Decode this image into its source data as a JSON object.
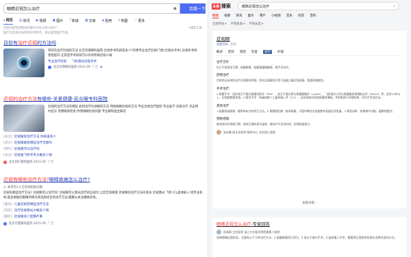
{
  "baidu": {
    "query": "眼睛近视怎么治疗",
    "search_button": "百度一下",
    "tabs": [
      {
        "label": "网页",
        "icon": "search-icon",
        "glyph": "⌕"
      },
      {
        "label": "资讯",
        "icon": "news-icon",
        "glyph": "▤"
      },
      {
        "label": "视频",
        "icon": "video-icon",
        "glyph": "▶"
      },
      {
        "label": "图片",
        "icon": "image-icon",
        "glyph": "▣"
      },
      {
        "label": "知道",
        "icon": "question-icon",
        "glyph": "?"
      },
      {
        "label": "文库",
        "icon": "document-icon",
        "glyph": "▦"
      },
      {
        "label": "贴吧",
        "icon": "forum-icon",
        "glyph": "◈"
      },
      {
        "label": "地图",
        "icon": "map-pin-icon",
        "glyph": "⌾"
      },
      {
        "label": "更多",
        "icon": "more-icon",
        "glyph": "⋯"
      }
    ],
    "result_count": "百度为您找到相关结果约100,000,000个",
    "tools_label": "搜索工具",
    "tip": "医疗信息具有局限性仅供参考，请以医院医疗为准",
    "result1": {
      "title_a": "目前有",
      "title_em": "治疗近视",
      "title_b": "的方法吗",
      "desc": "目前有治疗近视的方法 北京华德眼科医院 近视手术年龄是多少?华德专业治疗近视(飞秒/全激光手术),近视手术改善度提升,尤其是手术前就可以有效帮助近视人群",
      "link1": "专业治疗近视",
      "link2": "飞秒激光近视手术",
      "site": "北京华德眼科医院 2021-09",
      "ad": "广告"
    },
    "result2": {
      "title_em": "近视的治疗方法",
      "title_b": "有哪些-关爱健康-民众眼专科医院",
      "desc": "近视的治疗方法有哪些 如何治疗近视眼的方法 预防眼睛近视的方法 专业近视治疗医院 专业医学 优质诊疗 点击预约挂号 免费眼部检查 改善眼睛近视问题 专业眼科医生解答",
      "subs": [
        {
          "label": "[关注]",
          "text": "近视眼的治疗方法 你知道多少"
        },
        {
          "label": "[问诊]",
          "text": "近视眼能有哪些治疗可能吗"
        },
        {
          "label": "[预约]",
          "text": "近视眼可以治疗吗"
        },
        {
          "label": "[关注]",
          "text": "近视金飞秒手术大概多少钱"
        }
      ],
      "site": "北京同仁眼科医院 2021-09",
      "ad": "广告"
    },
    "result3": {
      "title_em": "近视有哪些治疗方法?",
      "title_b": "眼睛疾病怎么治疗?",
      "note": "本月有1人已咨询相关问题",
      "desc": "近视有哪些治疗方法? 近视眼可以治疗吗? 近视眼可以激光治疗矫正视力 让您告别眼镜 近视眼的治疗方法有很多 近视激光 飞秒 ICL晶体植入 找专业机构,医生根据您眼睛的情况来选择适合的治疗方法,健康从关注眼睛开始。",
      "subs": [
        {
          "label": "[服务]",
          "text": "儿童近视有哪些治疗方法"
        },
        {
          "label": "[问答]",
          "text": "治疗近视激光大概多少钱"
        },
        {
          "label": "[服务]",
          "text": "近视眼多少度算严重"
        }
      ],
      "site": "北京华夏眼科医院 2021-09",
      "ad": "广告"
    }
  },
  "toutiao": {
    "logo_box": "头条",
    "logo_text": "搜索",
    "query": "眼睛近视怎么治疗",
    "tabs": [
      "综合",
      "视频",
      "资讯",
      "图片",
      "用户",
      "小视频",
      "音乐",
      "问答",
      "百科"
    ],
    "filters": [
      "全部时间",
      "不限来源",
      "不限长度"
    ],
    "card": {
      "title": "近视眼",
      "wiki": "百度百科",
      "wiki_extra": "疾病",
      "tabs": [
        "概述",
        "症状",
        "病因",
        "检查",
        "治疗",
        "护理"
      ],
      "active_tab": "治疗",
      "sections": [
        {
          "h": "治疗方针",
          "p": "针正不良视觉习惯、佩戴眼镜、配戴角膜接触镜、做手术治疗。"
        },
        {
          "h": "药物治疗",
          "p": "目前尚无有效的治疗近视眼的药物，阿托品滴眼剂可用于延缓儿童近视进展，需遵医嘱使用。"
        },
        {
          "h": "手术治疗",
          "p": "1.角膜手术：包括准分子激光角膜切削术（PRK）、准分子激光原位角膜磨镶术（LASIK）、飞秒激光小切口角膜基质透镜取出术（SMILE）等，适合18岁以上、近视度数稳定者。2.眼内手术：有晶体眼人工晶体植入术（ICL），适合高度近视或角膜较薄者。术前需进行详细检查，评估手术适应证。"
        },
        {
          "h": "其他治疗",
          "p": "1.配戴框架眼镜：最简单安全的矫正方法。2.角膜塑形镜：夜间佩戴，可暂时降低近视度数并延缓近视发展。3.视觉训练：改善调节功能，缓解视疲劳。"
        },
        {
          "h": "预防措施",
          "p": "养成良好的用眼习惯，保持正确的读写姿势，增加户外活动时间，定期检查视力。"
        }
      ],
      "author": "张永鹏 副主任医师 眼科中心 北京同仁医院",
      "more": "查看详情"
    },
    "qa": {
      "title_em": "眼睛近视怎么治疗",
      "title_b": "-专家回答",
      "author": "彭海燕 主任医师 浙江大学医学院附属第二医院",
      "desc": "如果眼睛近视的话，主要有以下几种治疗方法：1.配戴眼镜矫正视力；2.准分子激光手术；3.晶体植入手术，需要到正规医院检查后选择合适的方式。"
    }
  }
}
